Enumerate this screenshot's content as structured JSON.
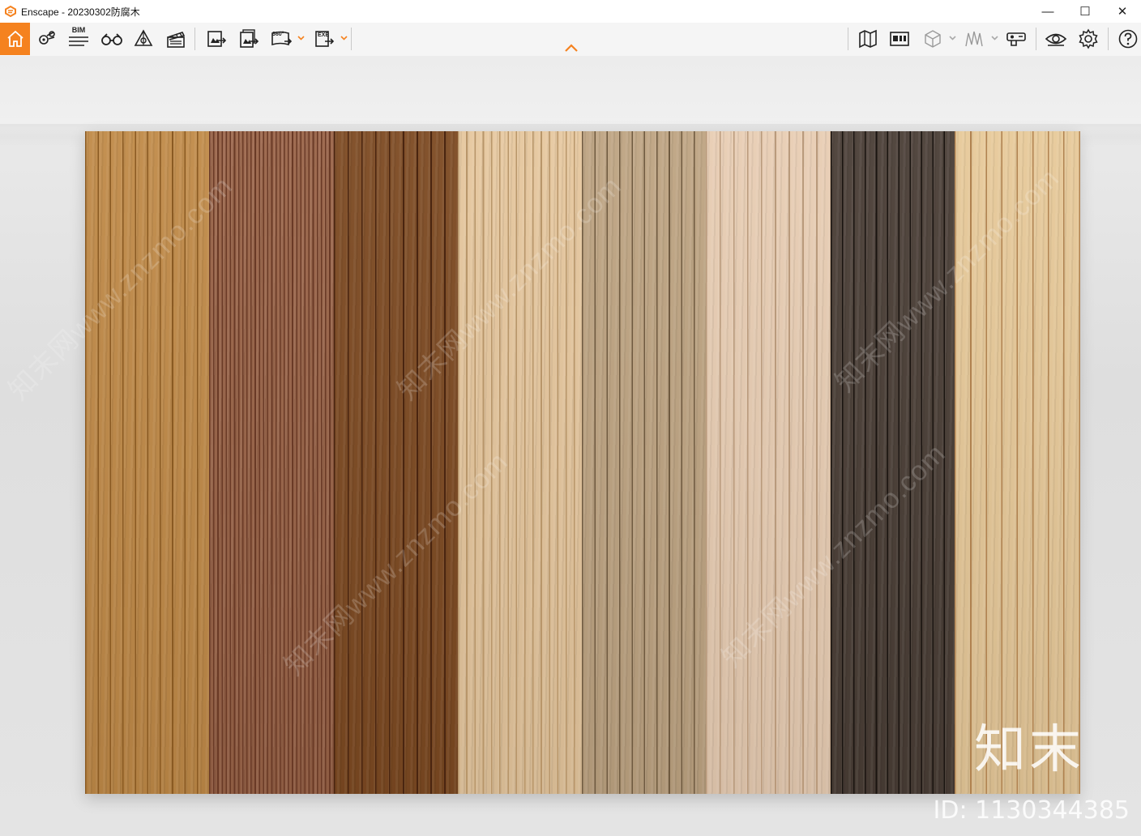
{
  "window": {
    "title": "Enscape - 20230302防腐木",
    "controls": {
      "minimize": "—",
      "maximize": "☐",
      "close": "✕"
    }
  },
  "toolbar": {
    "bim_label": "BIM",
    "pano_label": "360°",
    "exe_label": "EXE",
    "accent": "#f5821f"
  },
  "scene": {
    "panels": [
      {
        "base": "#c08a48",
        "dark": "#8a5a22",
        "grooves": 10
      },
      {
        "base": "#9a6448",
        "dark": "#6a3a26",
        "grooves": 30
      },
      {
        "base": "#7d4a22",
        "dark": "#4a2510",
        "grooves": 9
      },
      {
        "base": "#e6c79e",
        "dark": "#b8966a",
        "grooves": 15
      },
      {
        "base": "#bea482",
        "dark": "#6f5a40",
        "grooves": 10
      },
      {
        "base": "#e8cdb3",
        "dark": "#b99a7c",
        "grooves": 9
      },
      {
        "base": "#4a3e36",
        "dark": "#1a1410",
        "grooves": 11
      },
      {
        "base": "#e7c999",
        "dark": "#b08250",
        "grooves": 8
      }
    ],
    "watermark_text": "知末网www.znzmo.com",
    "brand": "知末",
    "id": "ID: 1130344385"
  }
}
